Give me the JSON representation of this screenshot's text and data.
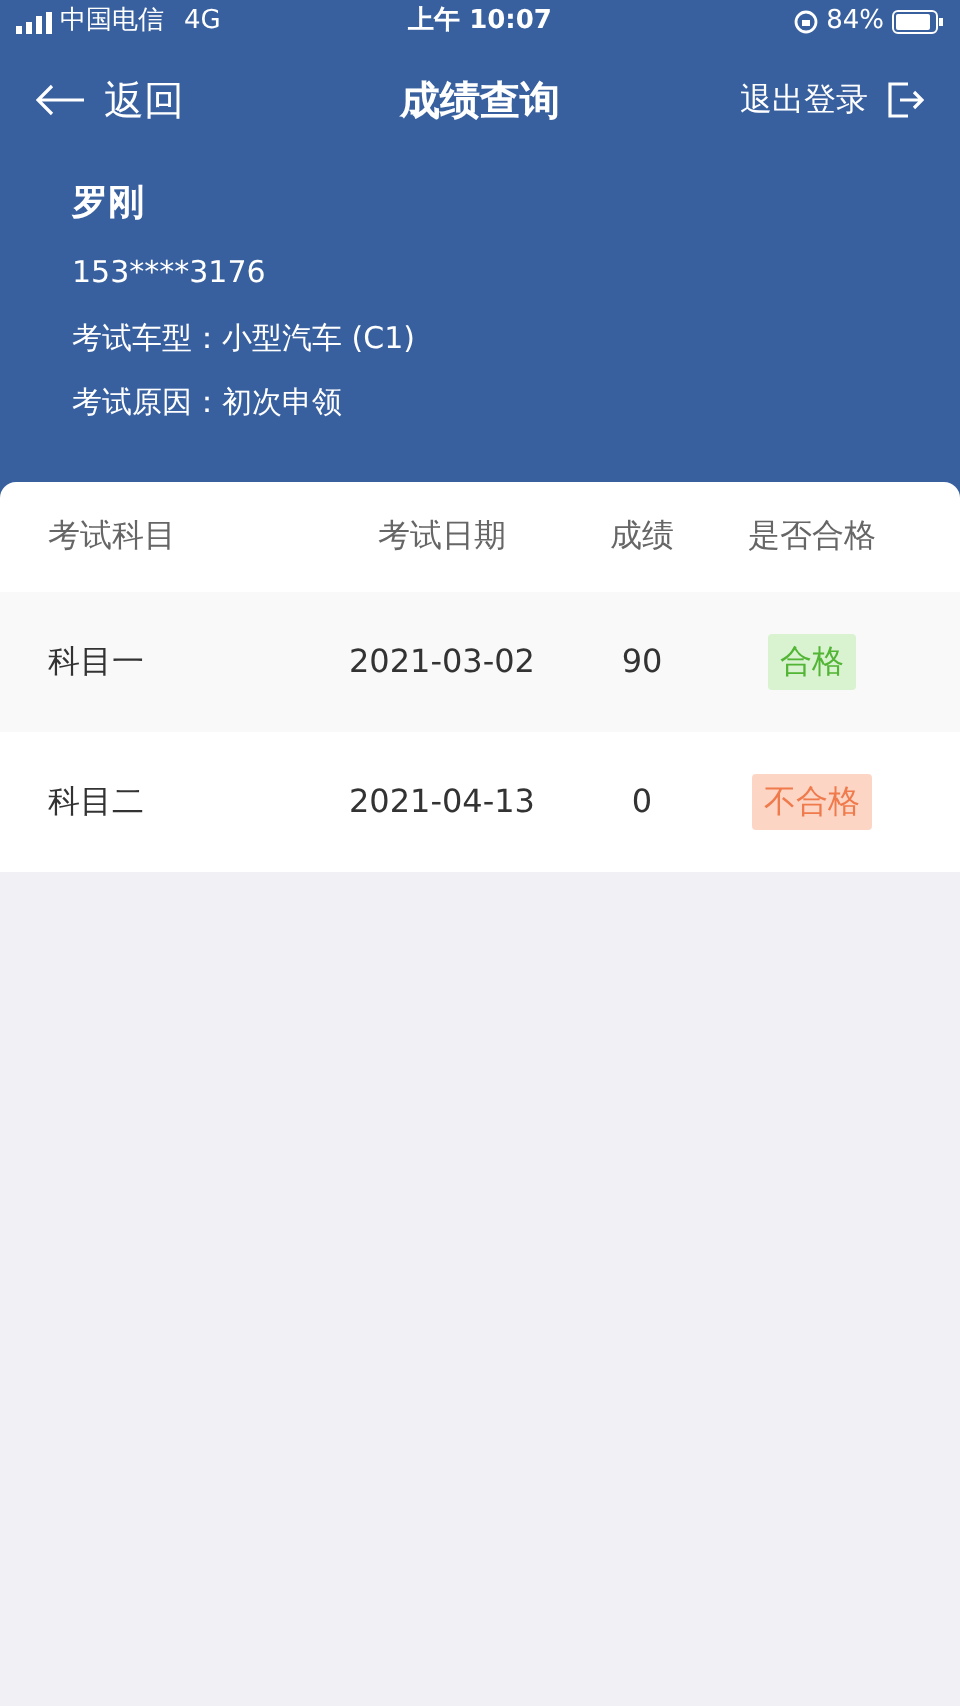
{
  "status_bar": {
    "carrier": "中国电信",
    "network": "4G",
    "time": "上午 10:07",
    "battery": "84%"
  },
  "nav": {
    "back": "返回",
    "title": "成绩查询",
    "logout": "退出登录"
  },
  "profile": {
    "name": "罗刚",
    "phone": "153****3176",
    "fields": [
      {
        "label": "考试车型：",
        "value": "小型汽车 (C1)"
      },
      {
        "label": "考试原因：",
        "value": "初次申领"
      }
    ]
  },
  "table": {
    "columns": [
      "考试科目",
      "考试日期",
      "成绩",
      "是否合格"
    ],
    "rows": [
      {
        "subject": "科目一",
        "date": "2021-03-02",
        "score": "90",
        "result": "合格",
        "passed": true
      },
      {
        "subject": "科目二",
        "date": "2021-04-13",
        "score": "0",
        "result": "不合格",
        "passed": false
      }
    ]
  }
}
